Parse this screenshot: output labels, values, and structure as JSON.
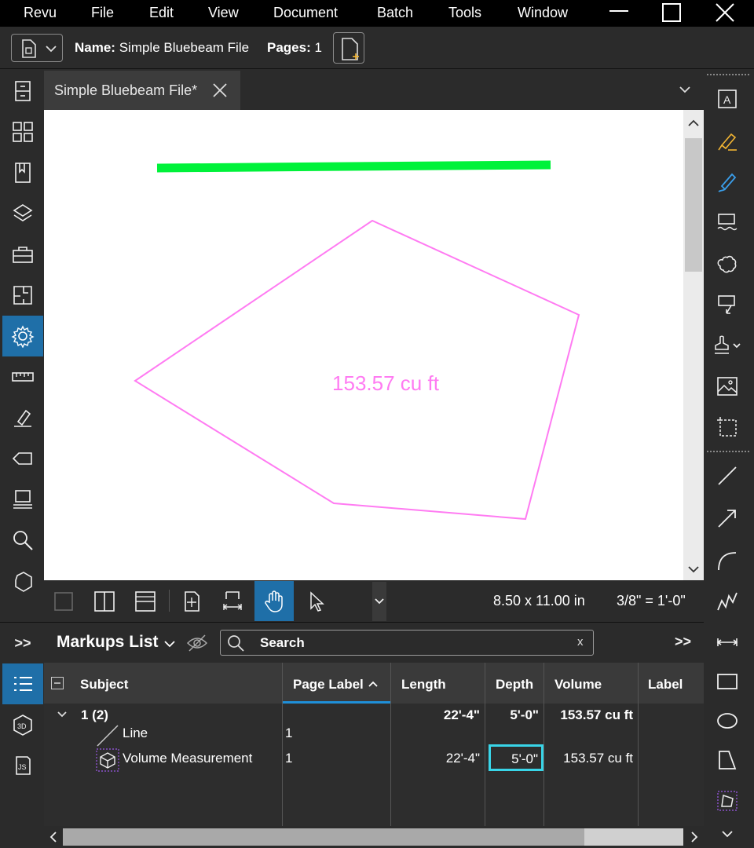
{
  "menu": {
    "items": [
      "Revu",
      "File",
      "Edit",
      "View",
      "Document",
      "Batch",
      "Tools",
      "Window"
    ]
  },
  "docbar": {
    "name_label": "Name:",
    "name_value": "Simple Bluebeam File",
    "pages_label": "Pages:",
    "pages_value": "1"
  },
  "tab": {
    "title": "Simple Bluebeam File*"
  },
  "canvas": {
    "volume_label": "153.57 cu ft",
    "line_color": "#00f23a",
    "polygon_color": "#ff7bf2"
  },
  "viewbar": {
    "page_size": "8.50 x 11.00 in",
    "scale": "3/8\" = 1'-0\""
  },
  "markups": {
    "title": "Markups List",
    "search_placeholder": "Search",
    "search_clear": "x",
    "expand_label": ">>",
    "collapse_label": ">>",
    "columns": [
      "Subject",
      "Page Label",
      "Length",
      "Depth",
      "Volume",
      "Label"
    ],
    "group": {
      "label": "1 (2)",
      "length": "22'-4\"",
      "depth": "5'-0\"",
      "volume": "153.57 cu ft"
    },
    "rows": [
      {
        "subject": "Line",
        "page_label": "1",
        "length": "",
        "depth": "",
        "volume": ""
      },
      {
        "subject": "Volume Measurement",
        "page_label": "1",
        "length": "22'-4\"",
        "depth": "5'-0\"",
        "volume": "153.57 cu ft"
      }
    ]
  },
  "colors": {
    "accent": "#1f6fa8",
    "edit_highlight": "#39d5e8",
    "panel_bg": "#2b2b2b"
  }
}
